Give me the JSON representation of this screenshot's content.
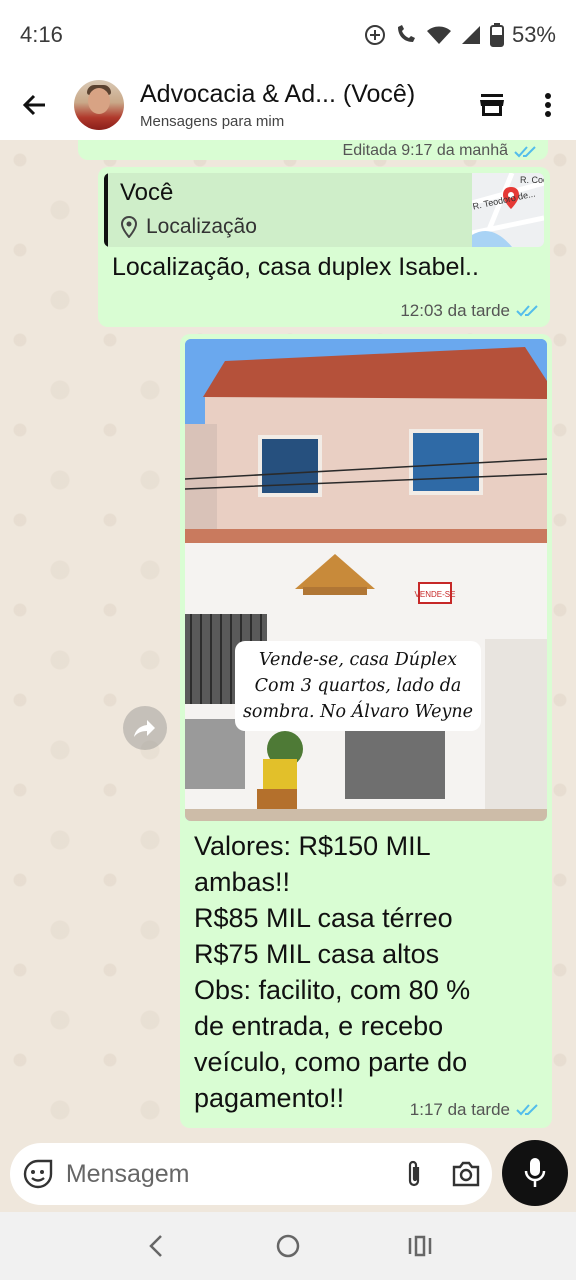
{
  "status_bar": {
    "time": "4:16",
    "battery": "53%",
    "icons": [
      "add-circle-icon",
      "wifi-call-icon",
      "wifi-icon",
      "signal-icon",
      "battery-icon"
    ]
  },
  "header": {
    "contact_name": "Advocacia & Ad... (Você)",
    "subtitle": "Mensagens para mim",
    "icons": [
      "back-arrow-icon",
      "store-icon",
      "more-vert-icon"
    ]
  },
  "messages": {
    "edited": {
      "meta": "Editada 9:17 da manhã"
    },
    "location": {
      "quote_author": "Você",
      "quote_text": "Localização",
      "map_label_1": "R. Teodoro de...",
      "map_label_2": "R. Coe",
      "text": "Localização, casa duplex Isabel..",
      "time": "12:03 da tarde"
    },
    "image": {
      "photo_overlay_lines": [
        "Vende-se, casa Dúplex",
        "Com 3 quartos, lado da",
        "sombra. No Álvaro Weyne"
      ],
      "sign_text": "VENDE-SE",
      "caption_lines": [
        "Valores: R$150 MIL",
        "ambas!!",
        "R$85 MIL casa térreo",
        "R$75 MIL casa altos",
        "Obs: facilito, com 80 %",
        "de entrada, e recebo",
        "veículo, como parte do",
        "pagamento!!"
      ],
      "time": "1:17 da tarde"
    }
  },
  "composer": {
    "placeholder": "Mensagem",
    "value": ""
  },
  "colors": {
    "bubble_out": "#d9fdd3",
    "chat_bg": "#efe7dc",
    "read_ticks": "#53bdeb"
  }
}
